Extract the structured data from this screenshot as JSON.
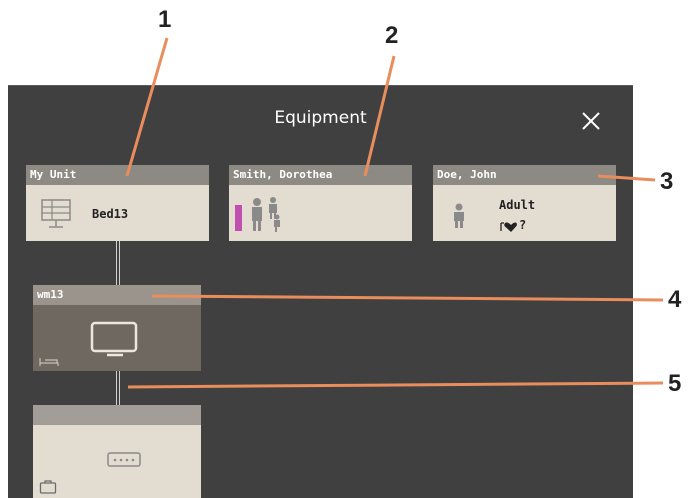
{
  "dialog": {
    "title": "Equipment",
    "close_icon": "close-icon"
  },
  "cards": {
    "my_unit": {
      "header": "My Unit",
      "label": "Bed13",
      "icon": "monitor-grid-icon"
    },
    "patient_smith": {
      "header": "Smith, Dorothea",
      "icon": "patient-group-icon",
      "accent_color": "#c14fb0"
    },
    "patient_doe": {
      "header": "Doe, John",
      "line1": "Adult",
      "line2": "?",
      "icon": "patient-icon",
      "status_icon": "heart-icon"
    },
    "device_wm13": {
      "header": "wm13",
      "icon": "display-icon",
      "bed_icon": "bed-icon"
    },
    "device_empty": {
      "header": "",
      "icon": "connector-port-icon",
      "case_icon": "case-icon"
    }
  },
  "callouts": [
    "1",
    "2",
    "3",
    "4",
    "5"
  ],
  "colors": {
    "callout_line": "#e98d5d",
    "panel": "#404040",
    "card": "#e2ddd0",
    "card_header": "#8d8a84"
  }
}
